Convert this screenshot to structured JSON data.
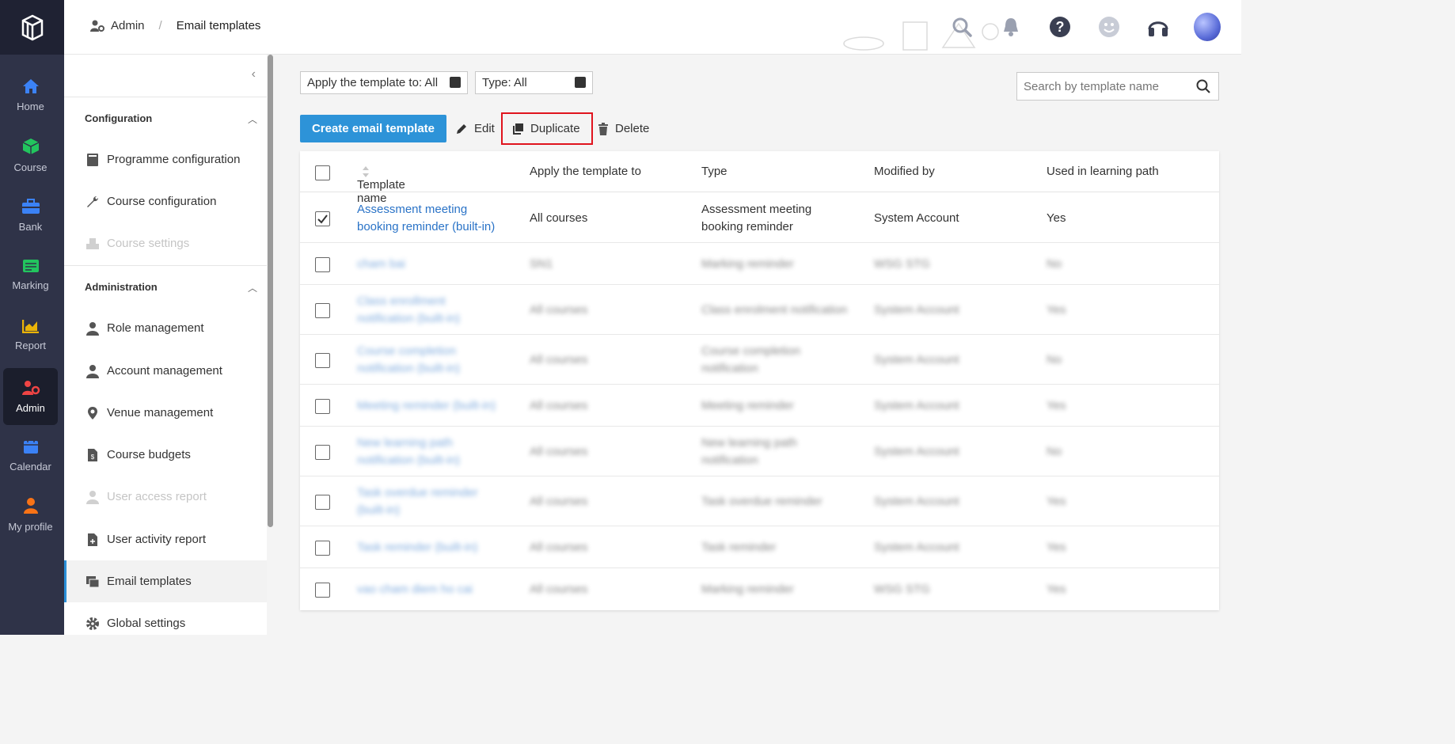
{
  "breadcrumb": {
    "section": "Admin",
    "current": "Email templates"
  },
  "nav": [
    {
      "label": "Home",
      "icon": "home-icon",
      "color": "#3b82f6"
    },
    {
      "label": "Course",
      "icon": "cube-icon",
      "color": "#22c55e"
    },
    {
      "label": "Bank",
      "icon": "bank-icon",
      "color": "#3b82f6"
    },
    {
      "label": "Marking",
      "icon": "marking-icon",
      "color": "#22c55e"
    },
    {
      "label": "Report",
      "icon": "report-icon",
      "color": "#eab308"
    },
    {
      "label": "Admin",
      "icon": "admin-icon",
      "color": "#ef4444"
    },
    {
      "label": "Calendar",
      "icon": "calendar-icon",
      "color": "#3b82f6"
    },
    {
      "label": "My profile",
      "icon": "profile-icon",
      "color": "#f97316"
    }
  ],
  "sidebar": {
    "configuration_title": "Configuration",
    "administration_title": "Administration",
    "config_items": [
      {
        "label": "Programme configuration"
      },
      {
        "label": "Course configuration"
      },
      {
        "label": "Course settings"
      }
    ],
    "admin_items": [
      {
        "label": "Role management"
      },
      {
        "label": "Account management"
      },
      {
        "label": "Venue management"
      },
      {
        "label": "Course budgets"
      },
      {
        "label": "User access report"
      },
      {
        "label": "User activity report"
      },
      {
        "label": "Email templates"
      },
      {
        "label": "Global settings"
      }
    ]
  },
  "filters": {
    "apply_to": "Apply the template to: All",
    "type": "Type: All",
    "search_placeholder": "Search by template name"
  },
  "toolbar": {
    "create": "Create email template",
    "edit": "Edit",
    "duplicate": "Duplicate",
    "delete": "Delete"
  },
  "table": {
    "headers": [
      "Template name",
      "Apply the template to",
      "Type",
      "Modified by",
      "Used in learning path"
    ],
    "rows": [
      {
        "name_1": "Assessment meeting",
        "name_2": "booking reminder (built-in)",
        "apply": "All courses",
        "type_1": "Assessment meeting",
        "type_2": "booking reminder",
        "modified": "System Account",
        "used": "Yes",
        "checked": true
      },
      {
        "name_1": "cham bai",
        "name_2": "",
        "apply": "SN1",
        "type_1": "Marking reminder",
        "type_2": "",
        "modified": "WSG STG",
        "used": "No",
        "checked": false
      },
      {
        "name_1": "Class enrollment",
        "name_2": "notification (built-in)",
        "apply": "All courses",
        "type_1": "Class enrolment notification",
        "type_2": "",
        "modified": "System Account",
        "used": "Yes",
        "checked": false
      },
      {
        "name_1": "Course completion",
        "name_2": "notification (built-in)",
        "apply": "All courses",
        "type_1": "Course completion",
        "type_2": "notification",
        "modified": "System Account",
        "used": "No",
        "checked": false
      },
      {
        "name_1": "Meeting reminder (built-in)",
        "name_2": "",
        "apply": "All courses",
        "type_1": "Meeting reminder",
        "type_2": "",
        "modified": "System Account",
        "used": "Yes",
        "checked": false
      },
      {
        "name_1": "New learning path",
        "name_2": "notification (built-in)",
        "apply": "All courses",
        "type_1": "New learning path",
        "type_2": "notification",
        "modified": "System Account",
        "used": "No",
        "checked": false
      },
      {
        "name_1": "Task overdue reminder",
        "name_2": "(built-in)",
        "apply": "All courses",
        "type_1": "Task overdue reminder",
        "type_2": "",
        "modified": "System Account",
        "used": "Yes",
        "checked": false
      },
      {
        "name_1": "Task reminder (built-in)",
        "name_2": "",
        "apply": "All courses",
        "type_1": "Task reminder",
        "type_2": "",
        "modified": "System Account",
        "used": "Yes",
        "checked": false
      },
      {
        "name_1": "vao cham diem ho cai",
        "name_2": "",
        "apply": "All courses",
        "type_1": "Marking reminder",
        "type_2": "",
        "modified": "WSG STG",
        "used": "Yes",
        "checked": false
      }
    ]
  },
  "colors": {
    "accent": "#2d93d8",
    "link": "#2a73c7",
    "highlight": "#e0141e",
    "nav_bg": "#2f3348"
  }
}
